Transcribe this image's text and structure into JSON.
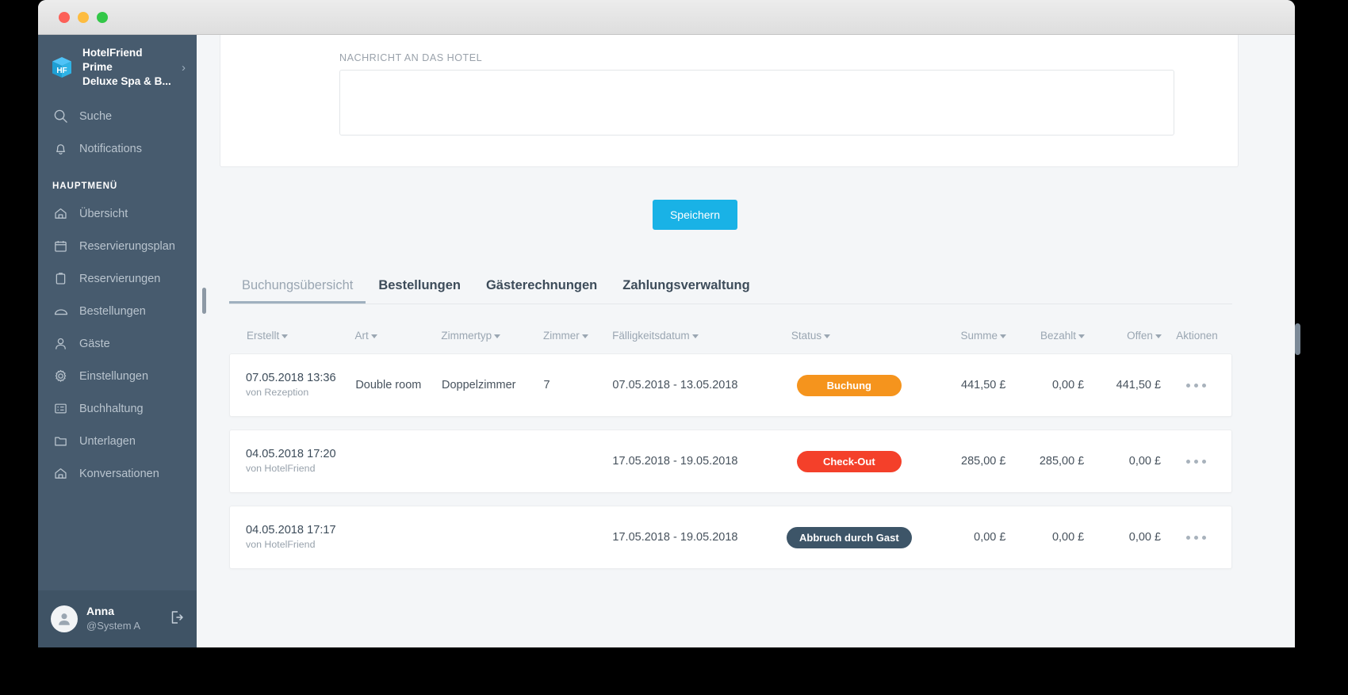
{
  "window": {
    "traffic_lights": [
      "close",
      "minimize",
      "maximize"
    ]
  },
  "sidebar": {
    "brand": {
      "line1": "HotelFriend Prime",
      "line2": "Deluxe Spa & B...",
      "chevron": "chevron-right-icon"
    },
    "top_items": [
      {
        "label": "Suche",
        "icon": "search-icon"
      },
      {
        "label": "Notifications",
        "icon": "bell-icon"
      }
    ],
    "section_title": "HAUPTMENÜ",
    "items": [
      {
        "label": "Übersicht",
        "icon": "home-icon"
      },
      {
        "label": "Reservierungsplan",
        "icon": "calendar-icon"
      },
      {
        "label": "Reservierungen",
        "icon": "clipboard-icon"
      },
      {
        "label": "Bestellungen",
        "icon": "room-service-icon"
      },
      {
        "label": "Gäste",
        "icon": "user-icon"
      },
      {
        "label": "Einstellungen",
        "icon": "gear-icon"
      },
      {
        "label": "Buchhaltung",
        "icon": "list-icon"
      },
      {
        "label": "Unterlagen",
        "icon": "folder-icon"
      },
      {
        "label": "Konversationen",
        "icon": "home-icon"
      }
    ],
    "profile": {
      "name": "Anna",
      "handle": "@System A",
      "logout_icon": "logout-icon",
      "avatar_icon": "avatar-icon"
    }
  },
  "main": {
    "message": {
      "label": "NACHRICHT AN DAS HOTEL",
      "value": "",
      "placeholder": ""
    },
    "save_label": "Speichern",
    "tabs": [
      {
        "label": "Buchungsübersicht",
        "active": true
      },
      {
        "label": "Bestellungen",
        "active": false
      },
      {
        "label": "Gästerechnungen",
        "active": false
      },
      {
        "label": "Zahlungsverwaltung",
        "active": false
      }
    ],
    "table": {
      "columns": [
        {
          "label": "Erstellt",
          "sortable": true
        },
        {
          "label": "Art",
          "sortable": true
        },
        {
          "label": "Zimmertyp",
          "sortable": true
        },
        {
          "label": "Zimmer",
          "sortable": true
        },
        {
          "label": "Fälligkeitsdatum",
          "sortable": true
        },
        {
          "label": "Status",
          "sortable": true
        },
        {
          "label": "Summe",
          "sortable": true
        },
        {
          "label": "Bezahlt",
          "sortable": true
        },
        {
          "label": "Offen",
          "sortable": true
        },
        {
          "label": "Aktionen",
          "sortable": false
        }
      ],
      "rows": [
        {
          "created_date": "07.05.2018 13:36",
          "created_by": "von Rezeption",
          "art": "Double room",
          "zimmertyp": "Doppelzimmer",
          "zimmer": "7",
          "faelligkeitsdatum": "07.05.2018 - 13.05.2018",
          "status": "Buchung",
          "status_color": "#f5941d",
          "summe": "441,50 £",
          "bezahlt": "0,00 £",
          "offen": "441,50 £",
          "actions": "more-actions-icon"
        },
        {
          "created_date": "04.05.2018 17:20",
          "created_by": "von HotelFriend",
          "art": "",
          "zimmertyp": "",
          "zimmer": "",
          "faelligkeitsdatum": "17.05.2018 - 19.05.2018",
          "status": "Check-Out",
          "status_color": "#f4402a",
          "summe": "285,00 £",
          "bezahlt": "285,00 £",
          "offen": "0,00 £",
          "actions": "more-actions-icon"
        },
        {
          "created_date": "04.05.2018 17:17",
          "created_by": "von HotelFriend",
          "art": "",
          "zimmertyp": "",
          "zimmer": "",
          "faelligkeitsdatum": "17.05.2018 - 19.05.2018",
          "status": "Abbruch durch Gast",
          "status_color": "#3d5568",
          "summe": "0,00 £",
          "bezahlt": "0,00 £",
          "offen": "0,00 £",
          "actions": "more-actions-icon"
        }
      ]
    }
  },
  "colors": {
    "accent": "#19b2e6",
    "sidebar_bg": "#475b6e",
    "page_bg": "#f4f6f8",
    "status_booking": "#f5941d",
    "status_checkout": "#f4402a",
    "status_cancelled": "#3d5568"
  }
}
